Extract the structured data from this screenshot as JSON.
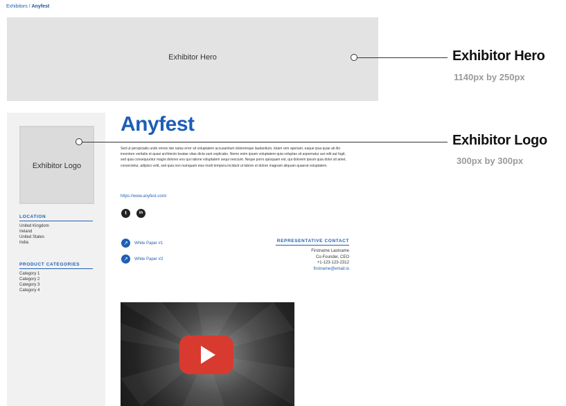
{
  "breadcrumb": {
    "parent": "Exhibitors",
    "separator": " / ",
    "current": "Anyfest"
  },
  "hero": {
    "label": "Exhibitor Hero"
  },
  "callouts": {
    "hero": {
      "title": "Exhibitor Hero",
      "size": "1140px by 250px"
    },
    "logo": {
      "title": "Exhibitor Logo",
      "size": "300px by 300px"
    }
  },
  "sidebar": {
    "logo_label": "Exhibitor Logo",
    "location": {
      "heading": "LOCATION",
      "items": [
        "United Kingdom",
        "Ireland",
        "United States",
        "India"
      ]
    },
    "categories": {
      "heading": "PRODUCT CATEGORIES",
      "items": [
        "Category 1",
        "Category 2",
        "Category 3",
        "Category 4"
      ]
    }
  },
  "exhibitor": {
    "name": "Anyfest",
    "description": "Sed ut perspiciatis unde omnis iste natus error sit voluptatem accusantium doloremque laudantium, totam rem aperiam, eaque ipsa quae ab illo inventore veritatis et quasi architecto beatae vitae dicta sunt explicabo. Nemo enim ipsam voluptatem quia voluptas sit aspernatur aut odit aut fugit, sed quia consequuntur magni dolores eos qui ratione voluptatem sequi nesciunt. Neque porro quisquam est, qui dolorem ipsum quia dolor sit amet, consectetur, adipisci velit, sed quia non numquam eius modi tempora incidunt ut labore et dolore magnam aliquam quaerat voluptatem.",
    "website": "https://www.anyfest.com/",
    "social": [
      {
        "icon": "twitter-icon",
        "glyph": "t"
      },
      {
        "icon": "linkedin-icon",
        "glyph": "in"
      }
    ]
  },
  "papers": [
    {
      "icon": "arrow-icon",
      "label": "White Paper #1"
    },
    {
      "icon": "arrow-icon",
      "label": "White Paper #2"
    }
  ],
  "representative": {
    "heading": "REPRESENTATIVE CONTACT",
    "name": "Firstname Lastname",
    "title": "Co-Founder, CEO",
    "phone": "+1-123-123-2312",
    "email": "firstname@email.io"
  },
  "video": {
    "icon": "play-icon"
  },
  "colors": {
    "accent": "#1f5fb0",
    "hero_bg": "#e4e3e4",
    "sidebar_bg": "#f1f1f1",
    "play_red": "#d93a30"
  }
}
